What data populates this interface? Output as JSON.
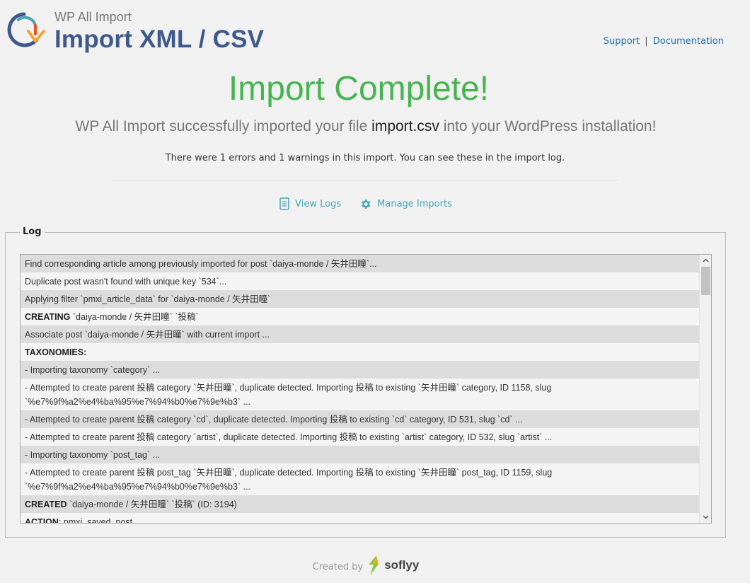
{
  "header": {
    "brand_small": "WP All Import",
    "brand_title": "Import XML / CSV",
    "support_link": "Support",
    "separator": "|",
    "documentation_link": "Documentation"
  },
  "complete": {
    "title": "Import Complete!",
    "subtitle_prefix": "WP All Import successfully imported your file",
    "file_name": "import.csv",
    "subtitle_suffix": "into your WordPress installation!",
    "notice": "There were 1 errors and 1 warnings in this import. You can see these in the import log."
  },
  "actions": {
    "view_logs": "View Logs",
    "manage_imports": "Manage Imports"
  },
  "log": {
    "legend": "Log",
    "lines": [
      {
        "strong": "",
        "text": "Find corresponding article among previously imported for post `daiya-monde / 矢井田瞳`..."
      },
      {
        "strong": "",
        "text": "Duplicate post wasn't found with unique key `534`..."
      },
      {
        "strong": "",
        "text": "Applying filter `pmxi_article_data` for `daiya-monde / 矢井田瞳`"
      },
      {
        "strong": "CREATING",
        "text": " `daiya-monde / 矢井田瞳` `投稿`"
      },
      {
        "strong": "",
        "text": "Associate post `daiya-monde / 矢井田瞳` with current import ..."
      },
      {
        "strong": "TAXONOMIES:",
        "text": ""
      },
      {
        "strong": "",
        "text": "- Importing taxonomy `category` ..."
      },
      {
        "strong": "",
        "text": "- Attempted to create parent 投稿 category `矢井田瞳`, duplicate detected. Importing 投稿 to existing `矢井田瞳` category, ID 1158, slug `%e7%9f%a2%e4%ba%95%e7%94%b0%e7%9e%b3` ..."
      },
      {
        "strong": "",
        "text": "- Attempted to create parent 投稿 category `cd`, duplicate detected. Importing 投稿 to existing `cd` category, ID 531, slug `cd` ..."
      },
      {
        "strong": "",
        "text": "- Attempted to create parent 投稿 category `artist`, duplicate detected. Importing 投稿 to existing `artist` category, ID 532, slug `artist` ..."
      },
      {
        "strong": "",
        "text": "- Importing taxonomy `post_tag` ..."
      },
      {
        "strong": "",
        "text": "- Attempted to create parent 投稿 post_tag `矢井田瞳`, duplicate detected. Importing 投稿 to existing `矢井田瞳` post_tag, ID 1159, slug `%e7%9f%a2%e4%ba%95%e7%94%b0%e7%9e%b3` ..."
      },
      {
        "strong": "CREATED",
        "text": " `daiya-monde / 矢井田瞳` `投稿` (ID: 3194)"
      },
      {
        "strong": "ACTION",
        "text": ": pmxi_saved_post"
      }
    ]
  },
  "footer": {
    "created_by": "Created by",
    "company": "soflyy"
  },
  "colors": {
    "brand_title": "#40598b",
    "success_green": "#46b450",
    "link_blue": "#2271b1",
    "action_teal": "#46a5b5"
  }
}
